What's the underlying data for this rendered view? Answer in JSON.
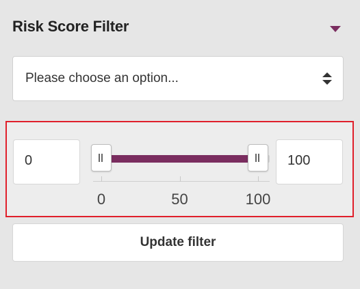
{
  "panel": {
    "title": "Risk Score Filter",
    "collapse_icon": "triangle-down-icon",
    "accent_color": "#7a2d5f",
    "highlight_color": "#e01f2a"
  },
  "select": {
    "value": "Please choose an option...",
    "icon": "sort-arrows-icon"
  },
  "range": {
    "min_value": "0",
    "max_value": "100",
    "slider_min": 0,
    "slider_max": 100,
    "selected_low": 0,
    "selected_high": 100,
    "ticks": [
      {
        "value": 0,
        "label": "0"
      },
      {
        "value": 50,
        "label": "50"
      },
      {
        "value": 100,
        "label": "100"
      }
    ]
  },
  "button": {
    "label": "Update filter"
  }
}
